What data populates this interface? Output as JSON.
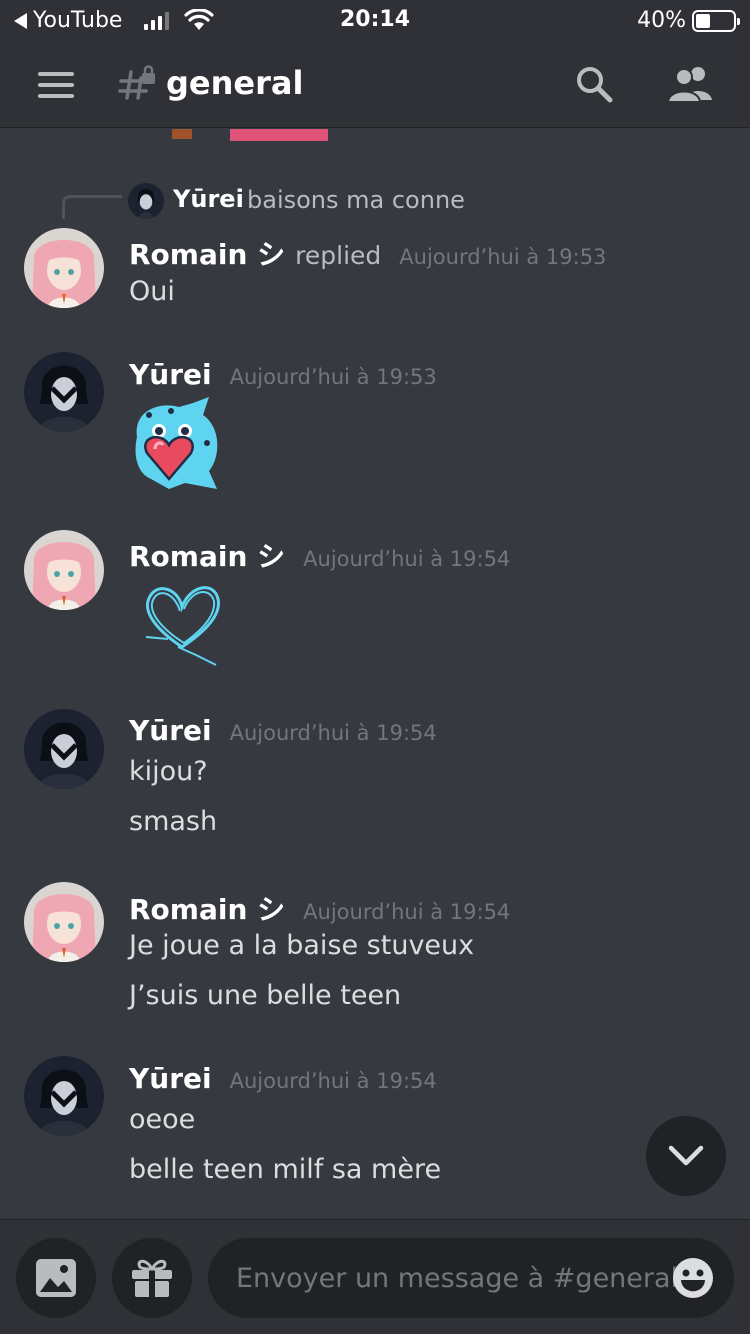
{
  "status_bar": {
    "back_app": "YouTube",
    "time": "20:14",
    "battery_percent": "40%",
    "battery_level": 0.4
  },
  "header": {
    "channel": "general"
  },
  "chat": {
    "reply_ref": {
      "author": "Yūrei",
      "text": "baisons ma conne"
    },
    "messages": [
      {
        "author": "Romain シ",
        "replied": "replied",
        "timestamp": "Aujourd’hui à 19:53",
        "lines": [
          "Oui"
        ]
      },
      {
        "author": "Yūrei",
        "timestamp": "Aujourd’hui à 19:53",
        "sticker": "heart-creature-sticker"
      },
      {
        "author": "Romain シ",
        "timestamp": "Aujourd’hui à 19:54",
        "sticker": "blue-heart-sticker"
      },
      {
        "author": "Yūrei",
        "timestamp": "Aujourd’hui à 19:54",
        "lines": [
          "kijou?",
          "smash"
        ]
      },
      {
        "author": "Romain シ",
        "timestamp": "Aujourd’hui à 19:54",
        "lines": [
          "Je joue a la baise stuveux",
          "J’suis une belle teen"
        ]
      },
      {
        "author": "Yūrei",
        "timestamp": "Aujourd’hui à 19:54",
        "lines": [
          "oeoe",
          "belle teen milf sa mère"
        ]
      }
    ]
  },
  "composer": {
    "placeholder": "Envoyer un message à #general"
  },
  "colors": {
    "background": "#36393f",
    "header": "#2f3136",
    "dark": "#202225",
    "blurple_sticker": "#5fd4f0"
  }
}
